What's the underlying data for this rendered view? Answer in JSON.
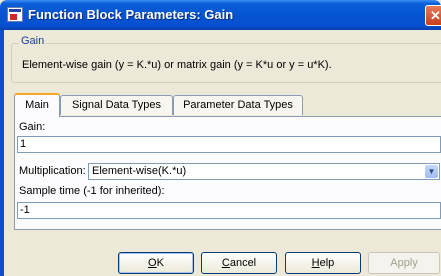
{
  "window": {
    "title": "Function Block Parameters: Gain",
    "close_glyph": "✕"
  },
  "block": {
    "group_title": "Gain",
    "description": "Element-wise gain (y = K.*u) or matrix gain (y = K*u or y = u*K)."
  },
  "tabs": [
    {
      "label": "Main",
      "active": true
    },
    {
      "label": "Signal Data Types",
      "active": false
    },
    {
      "label": "Parameter Data Types",
      "active": false
    }
  ],
  "fields": {
    "gain": {
      "label": "Gain:",
      "value": "1"
    },
    "multiplication": {
      "label": "Multiplication:",
      "value": "Element-wise(K.*u)"
    },
    "sample_time": {
      "label": "Sample time (-1 for inherited):",
      "value": "-1"
    }
  },
  "buttons": {
    "ok": {
      "label": "OK",
      "mnemonic": "O",
      "rest": "K"
    },
    "cancel": {
      "label": "Cancel",
      "mnemonic": "C",
      "rest": "ancel"
    },
    "help": {
      "label": "Help",
      "mnemonic": "H",
      "rest": "elp"
    },
    "apply": {
      "label": "Apply",
      "enabled": false
    }
  },
  "colors": {
    "titlebar": "#0554d0",
    "group_title": "#1b3ca8",
    "active_tab_accent": "#f5a623"
  }
}
